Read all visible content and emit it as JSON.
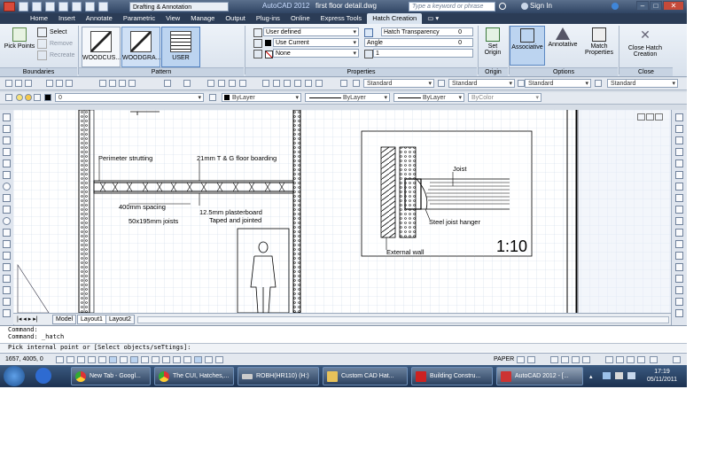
{
  "colors": {
    "accent": "#2b3c56",
    "ribbon": "#dbe4ef",
    "grid": "#c9d6e6"
  },
  "titlebar": {
    "workspace": "Drafting & Annotation",
    "app": "AutoCAD 2012",
    "file": "first floor detail.dwg",
    "search_placeholder": "Type a keyword or phrase",
    "signin": "Sign In"
  },
  "tabs": [
    "Home",
    "Insert",
    "Annotate",
    "Parametric",
    "View",
    "Manage",
    "Output",
    "Plug-ins",
    "Online",
    "Express Tools",
    "Hatch Creation"
  ],
  "ribbon": {
    "boundaries": {
      "title": "Boundaries",
      "pick_points": "Pick Points",
      "select": "Select",
      "remove": "Remove",
      "recreate": "Recreate"
    },
    "pattern": {
      "title": "Pattern",
      "swatches": [
        "WOODCUS...",
        "WOODGRA...",
        "USER"
      ]
    },
    "properties": {
      "title": "Properties",
      "type": "User defined",
      "color": "Use Current",
      "background": "None",
      "transparency_label": "Hatch Transparency",
      "transparency_value": "0",
      "angle_label": "Angle",
      "angle_value": "0",
      "spacing_value": "1"
    },
    "origin": {
      "title": "Origin",
      "set_origin": "Set Origin"
    },
    "options": {
      "title": "Options",
      "associative": "Associative",
      "annotative": "Annotative",
      "match_properties": "Match Properties"
    },
    "close": {
      "title": "Close",
      "label": "Close Hatch Creation"
    }
  },
  "toolbar2": {
    "layer": "0",
    "color": "ByLayer",
    "linetype": "ByLayer",
    "lineweight": "ByLayer",
    "plotstyle": "ByColor"
  },
  "toolbar1": {
    "textstyle": "Standard",
    "dimstyle": "Standard",
    "tablestyle": "Standard",
    "mleaderstyle": "Standard"
  },
  "drawing": {
    "labels": {
      "perimeter": "Perimeter strutting",
      "boarding": "21mm T & G floor boarding",
      "spacing": "400mm spacing",
      "joists": "50x195mm joists",
      "plasterboard1": "12.5mm plasterboard",
      "plasterboard2": "Taped and jointed",
      "joist": "Joist",
      "hanger": "Steel joist hanger",
      "external_wall": "External wall",
      "scale": "1:10"
    }
  },
  "layout_tabs": [
    "Model",
    "Layout1",
    "Layout2"
  ],
  "command": {
    "line1": "Command:",
    "line2": "Command:  _hatch",
    "prompt": "Pick internal point or [Select objects/seTtings]:"
  },
  "status": {
    "coords": "1657, 4005, 0",
    "paper": "PAPER"
  },
  "taskbar": {
    "items": [
      "New Tab - Googl...",
      "The CUI, Hatches,...",
      "ROBH(HR110) (H:)",
      "Custom CAD Hat...",
      "Building Constru...",
      "AutoCAD 2012 - [..."
    ],
    "time": "17:19",
    "date": "05/11/2011"
  }
}
